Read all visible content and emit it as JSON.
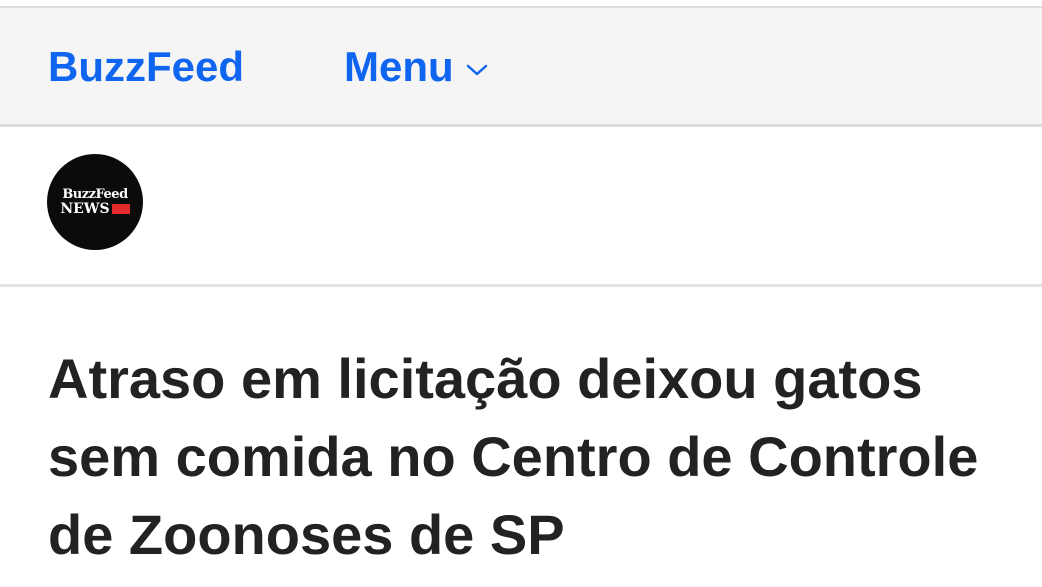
{
  "header": {
    "brand_label": "BuzzFeed",
    "menu_label": "Menu",
    "menu_icon": "chevron-down-icon"
  },
  "section_logo": {
    "line1": "BuzzFeed",
    "line2": "NEWS",
    "flag_color": "#e32b2b"
  },
  "article": {
    "headline": "Atraso em licitação deixou gatos sem comida no Centro de Controle de Zoonoses de SP"
  },
  "colors": {
    "accent": "#0f65ef",
    "headline": "#222222"
  }
}
